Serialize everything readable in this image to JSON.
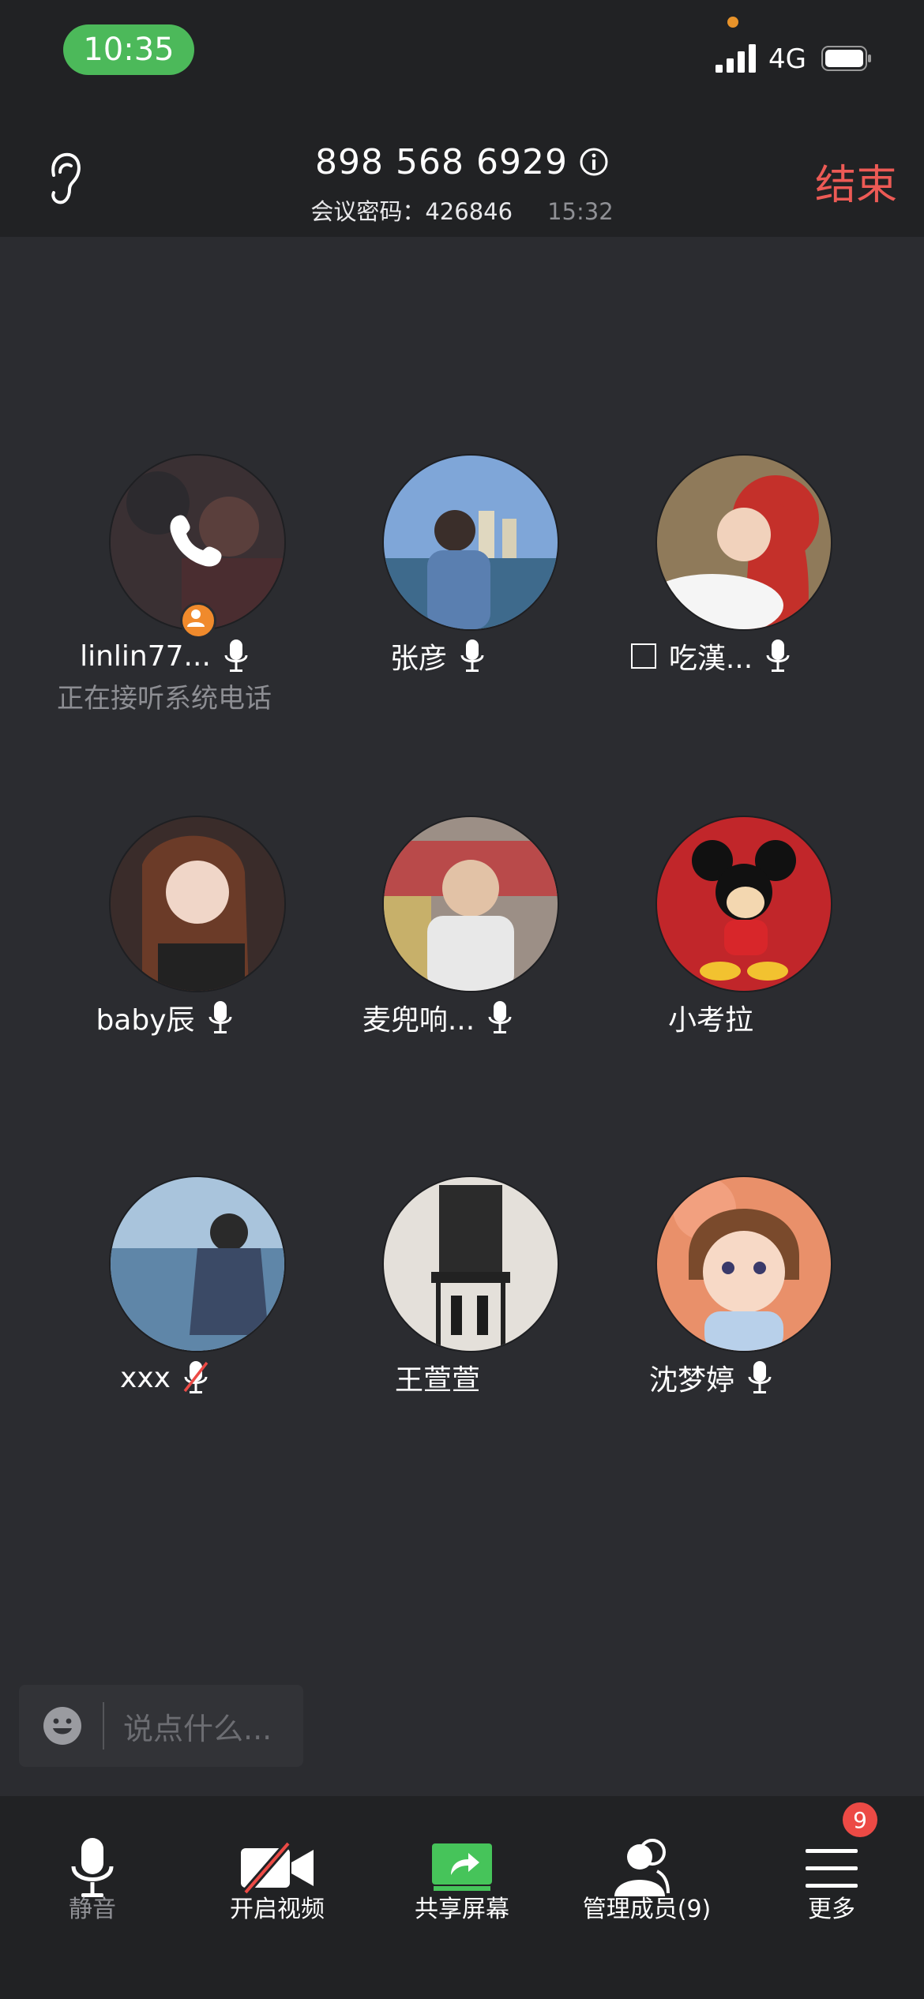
{
  "status_bar": {
    "time": "10:35",
    "network": "4G"
  },
  "header": {
    "meeting_id": "898 568 6929",
    "password_label": "会议密码：",
    "password": "426846",
    "elapsed": "15:32",
    "end_label": "结束"
  },
  "participants": [
    {
      "name": "linlin77...",
      "status": "正在接听系统电话"
    },
    {
      "name": "张彦"
    },
    {
      "name": "吃漢..."
    },
    {
      "name": "baby辰"
    },
    {
      "name": "麦兜响..."
    },
    {
      "name": "小考拉"
    },
    {
      "name": "xxx"
    },
    {
      "name": "王萱萱"
    },
    {
      "name": "沈梦婷"
    }
  ],
  "chat": {
    "placeholder": "说点什么..."
  },
  "toolbar": {
    "mute": "静音",
    "video": "开启视频",
    "share": "共享屏幕",
    "manage": "管理成员(9)",
    "more": "更多",
    "more_badge": "9"
  },
  "colors": {
    "end": "#ec5a55",
    "time_pill": "#4cb95a",
    "share": "#46c45a",
    "badge": "#ec4a45",
    "host_badge": "#f08a2c"
  }
}
